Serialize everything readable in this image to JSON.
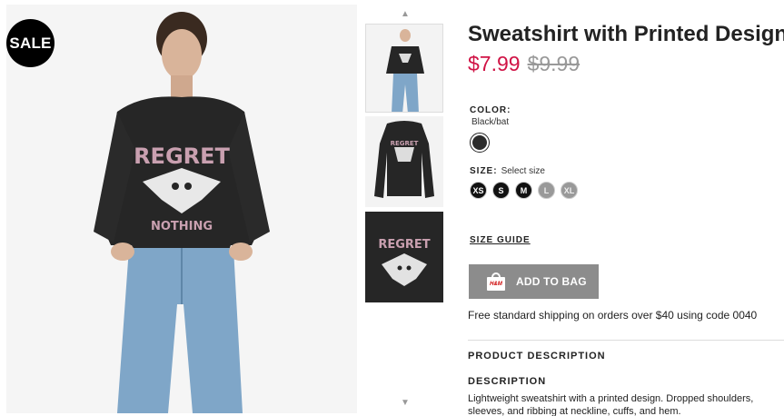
{
  "badge": {
    "sale": "SALE"
  },
  "product": {
    "title": "Sweatshirt with Printed Design",
    "price_sale": "$7.99",
    "price_original": "$9.99",
    "color_label": "COLOR:",
    "color_value": "Black/bat",
    "size_label": "SIZE:",
    "size_hint": "Select size",
    "sizes": [
      "XS",
      "S",
      "M",
      "L",
      "XL"
    ],
    "size_guide": "SIZE GUIDE",
    "add_to_bag": "ADD TO BAG",
    "bag_logo": "H&M",
    "shipping": "Free standard shipping on orders over $40 using code 0040",
    "product_description_heading": "PRODUCT DESCRIPTION",
    "description_heading": "DESCRIPTION",
    "description_text": "Lightweight sweatshirt with a printed design. Dropped shoulders, sleeves, and ribbing at neckline, cuffs, and hem."
  },
  "print": {
    "line1": "REGRET",
    "line2": "NOTHING"
  },
  "colors": {
    "sale_price": "#d01345",
    "add_button": "#8c8c8c",
    "swatch": "#2b2b2b",
    "sweatshirt": "#262626",
    "jeans": "#7fa6c8"
  },
  "icons": {
    "thumb_up": "chevron-up-icon",
    "thumb_down": "chevron-down-icon",
    "bag": "shopping-bag-icon"
  }
}
